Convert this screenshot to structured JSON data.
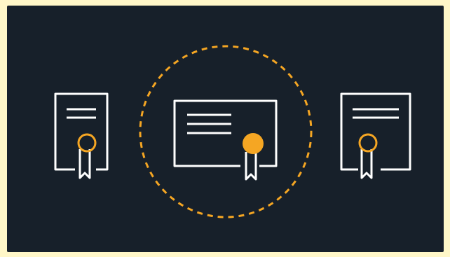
{
  "colors": {
    "outer_background": "#fff7c8",
    "panel_background": "#17202a",
    "line": "#ffffff",
    "accent": "#f5a623"
  },
  "icons": {
    "left": "certificate-portrait-icon",
    "center": "certificate-landscape-icon",
    "right": "certificate-portrait-icon",
    "highlight": "dashed-circle-highlight-icon"
  }
}
